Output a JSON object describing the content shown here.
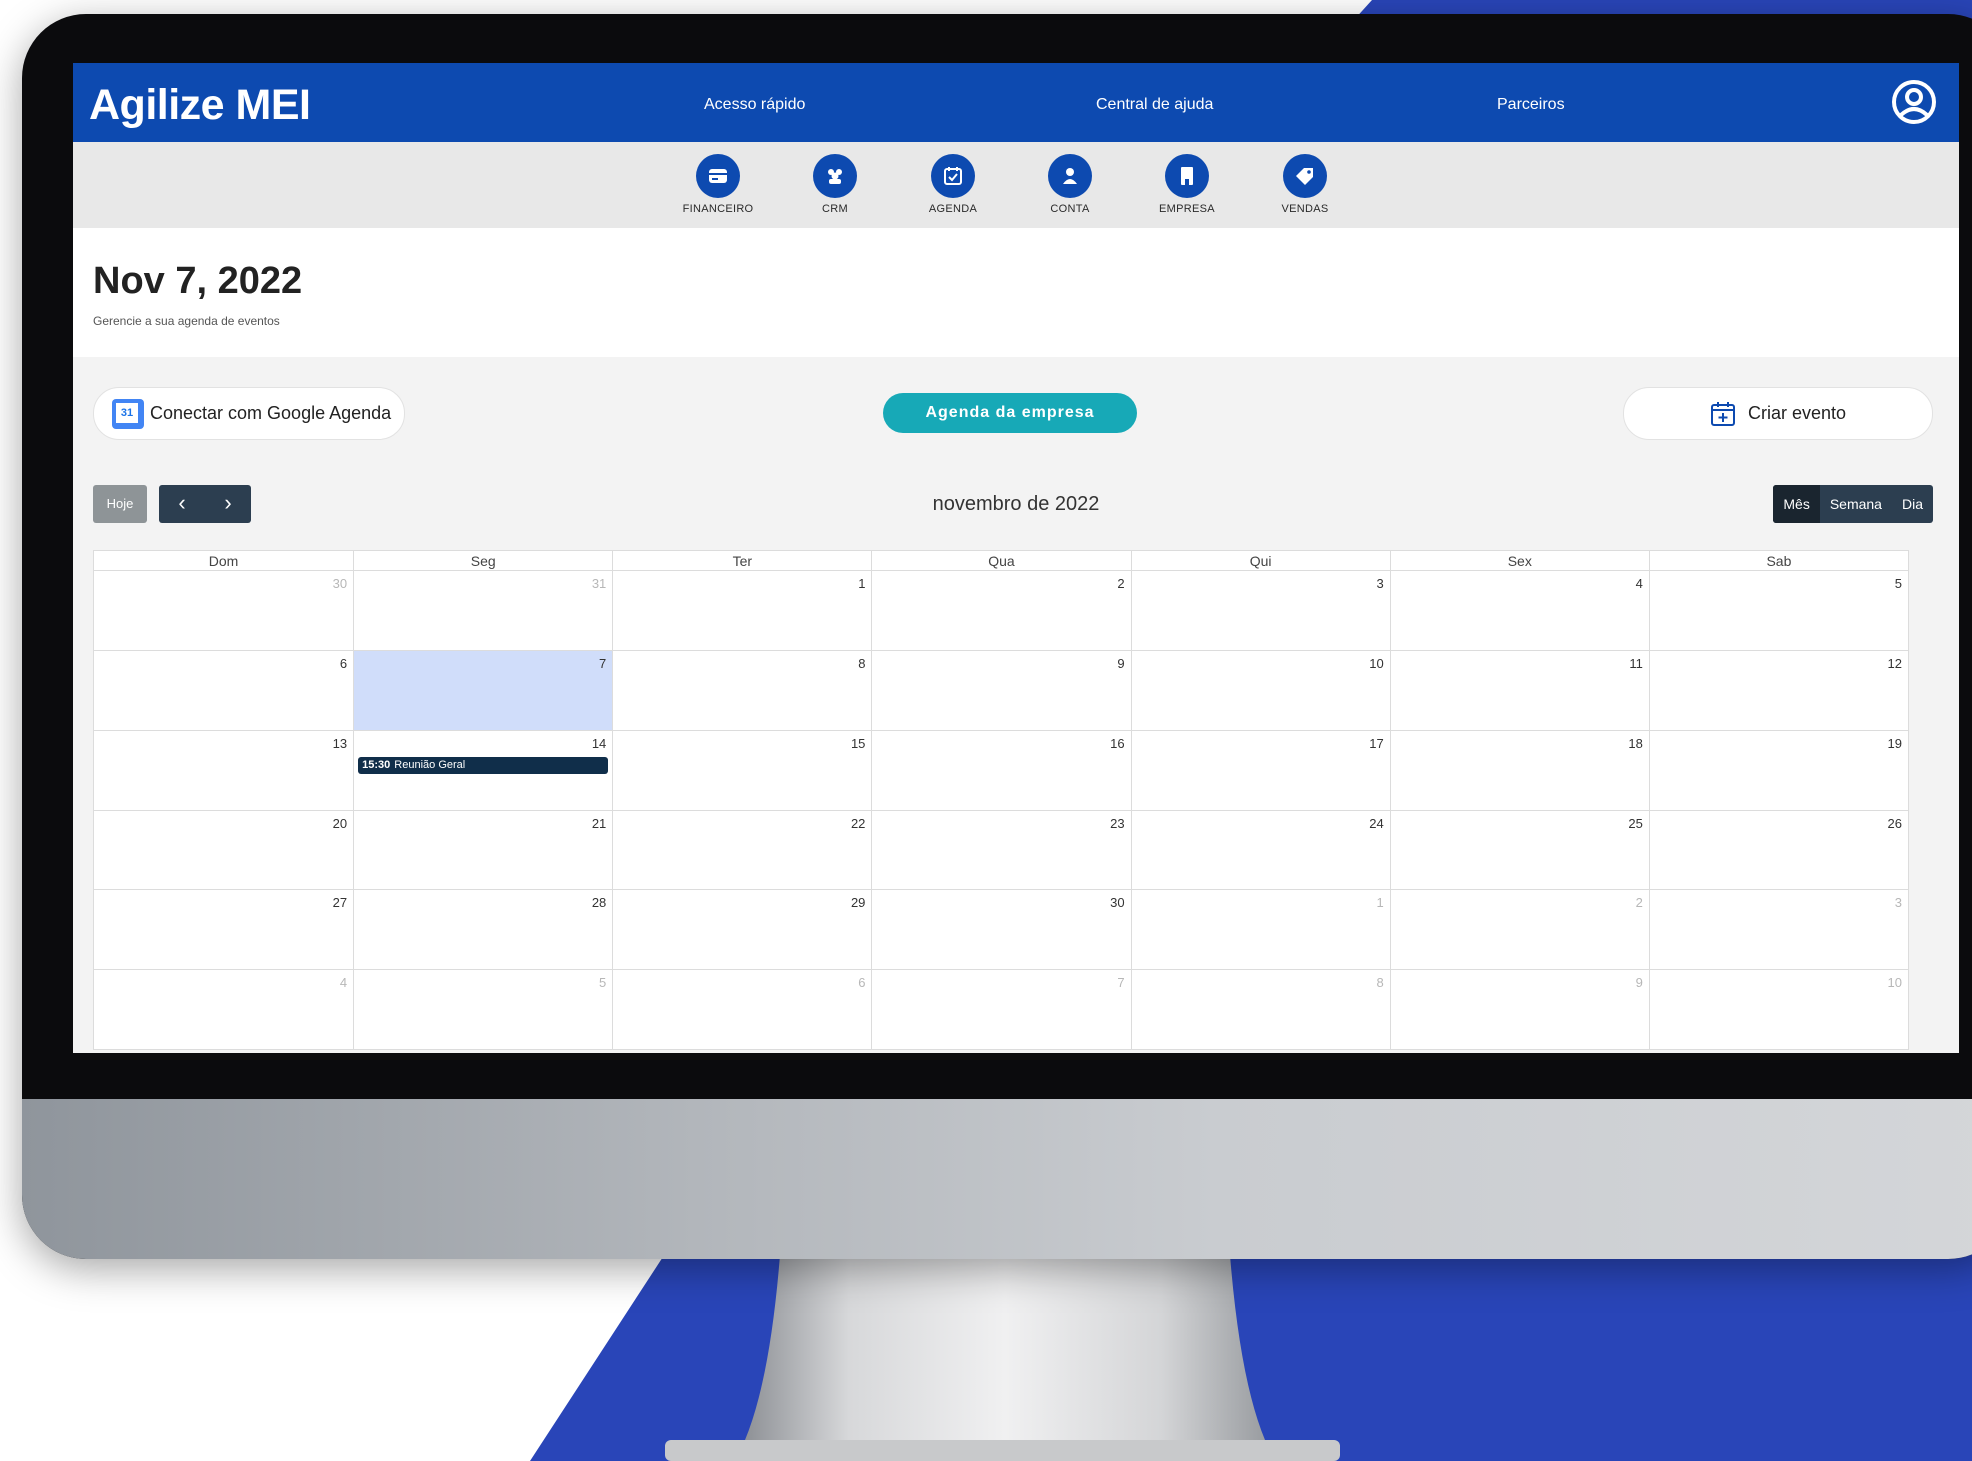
{
  "brand": {
    "name": "Agilize MEI",
    "primary_color": "#0d4ab0",
    "accent_color": "#17a9b7"
  },
  "topnav": {
    "items": [
      "Acesso rápido",
      "Central de ajuda",
      "Parceiros"
    ],
    "user_icon": "user-circle-icon"
  },
  "modules": [
    {
      "label": "FINANCEIRO",
      "icon": "wallet-icon"
    },
    {
      "label": "CRM",
      "icon": "users-icon"
    },
    {
      "label": "AGENDA",
      "icon": "calendar-check-icon"
    },
    {
      "label": "CONTA",
      "icon": "person-icon"
    },
    {
      "label": "EMPRESA",
      "icon": "building-icon"
    },
    {
      "label": "VENDAS",
      "icon": "tag-icon"
    }
  ],
  "page": {
    "title": "Nov 7, 2022",
    "subtitle": "Gerencie a sua agenda de eventos"
  },
  "actions": {
    "google_button": "Conectar com Google Agenda",
    "google_badge": "31",
    "agenda_button": "Agenda da empresa",
    "create_button": "Criar evento"
  },
  "toolbar": {
    "today": "Hoje",
    "prev": "‹",
    "next": "›",
    "month_title": "novembro de 2022",
    "views": [
      "Mês",
      "Semana",
      "Dia"
    ],
    "active_view": "Mês"
  },
  "calendar": {
    "weekdays": [
      "Dom",
      "Seg",
      "Ter",
      "Qua",
      "Qui",
      "Sex",
      "Sab"
    ],
    "weeks": [
      [
        {
          "d": "30",
          "off": true
        },
        {
          "d": "31",
          "off": true
        },
        {
          "d": "1"
        },
        {
          "d": "2"
        },
        {
          "d": "3"
        },
        {
          "d": "4"
        },
        {
          "d": "5"
        }
      ],
      [
        {
          "d": "6"
        },
        {
          "d": "7",
          "today": true
        },
        {
          "d": "8"
        },
        {
          "d": "9"
        },
        {
          "d": "10"
        },
        {
          "d": "11"
        },
        {
          "d": "12"
        }
      ],
      [
        {
          "d": "13"
        },
        {
          "d": "14",
          "event": {
            "time": "15:30",
            "title": "Reunião Geral"
          }
        },
        {
          "d": "15"
        },
        {
          "d": "16"
        },
        {
          "d": "17"
        },
        {
          "d": "18"
        },
        {
          "d": "19"
        }
      ],
      [
        {
          "d": "20"
        },
        {
          "d": "21"
        },
        {
          "d": "22"
        },
        {
          "d": "23"
        },
        {
          "d": "24"
        },
        {
          "d": "25"
        },
        {
          "d": "26"
        }
      ],
      [
        {
          "d": "27"
        },
        {
          "d": "28"
        },
        {
          "d": "29"
        },
        {
          "d": "30"
        },
        {
          "d": "1",
          "off": true
        },
        {
          "d": "2",
          "off": true
        },
        {
          "d": "3",
          "off": true
        }
      ],
      [
        {
          "d": "4",
          "off": true
        },
        {
          "d": "5",
          "off": true
        },
        {
          "d": "6",
          "off": true
        },
        {
          "d": "7",
          "off": true
        },
        {
          "d": "8",
          "off": true
        },
        {
          "d": "9",
          "off": true
        },
        {
          "d": "10",
          "off": true
        }
      ]
    ]
  }
}
